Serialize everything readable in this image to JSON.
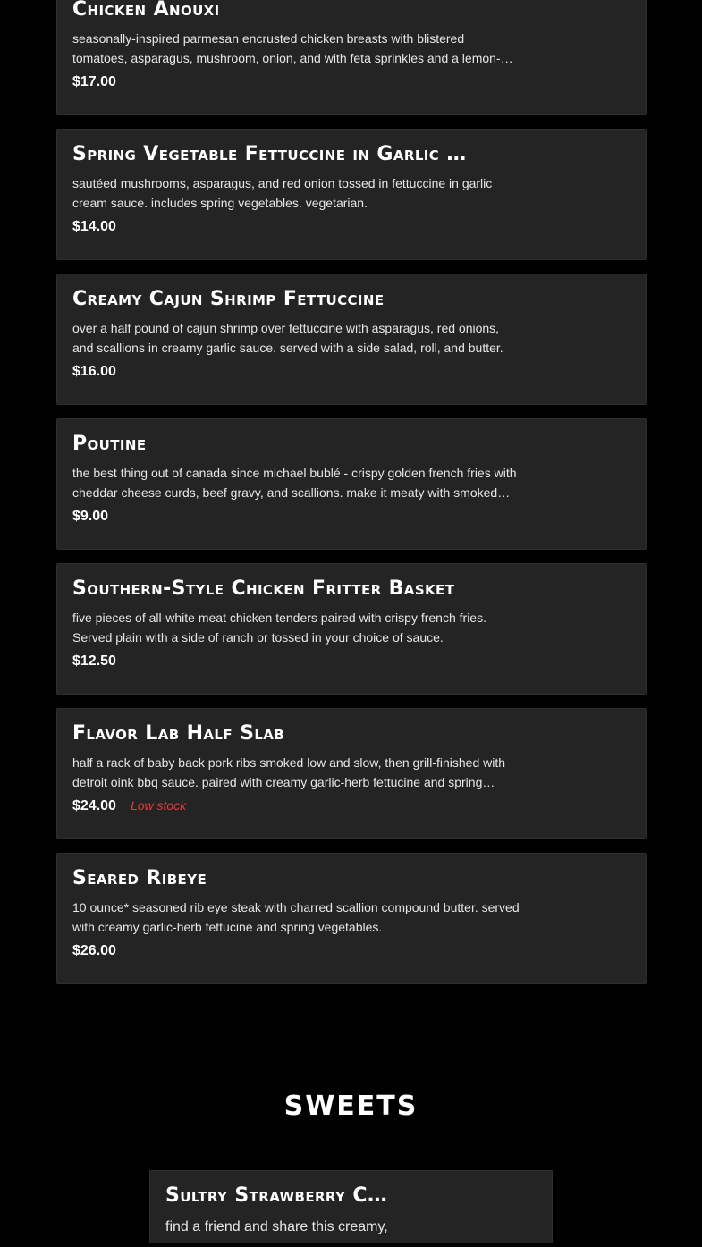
{
  "menu_items": [
    {
      "title": "Chicken Anouxi",
      "description": "seasonally-inspired parmesan encrusted chicken breasts with blistered tomatoes, asparagus, mushroom, onion, and with feta sprinkles and a lemon-herb cream sauce.",
      "price": "$17.00",
      "badge": ""
    },
    {
      "title": "Spring Vegetable Fettuccine in Garlic Cream Sauce",
      "description": "sautéed mushrooms, asparagus, and red onion tossed in fettuccine in garlic cream sauce. includes spring vegetables. vegetarian.",
      "price": "$14.00",
      "badge": ""
    },
    {
      "title": "Creamy Cajun Shrimp Fettuccine",
      "description": "over a half pound of cajun shrimp over fettuccine with asparagus, red onions, and scallions in creamy garlic sauce. served with a side salad, roll, and butter.",
      "price": "$16.00",
      "badge": ""
    },
    {
      "title": "Poutine",
      "description": "the best thing out of canada since michael bublé - crispy golden french fries with cheddar cheese curds, beef gravy, and scallions. make it meaty with smoked brisket or pulled pork.",
      "price": "$9.00",
      "badge": ""
    },
    {
      "title": "Southern-Style Chicken Fritter Basket",
      "description": "five pieces of all-white meat chicken tenders paired with crispy french fries. Served plain with a side of ranch or tossed in your choice of sauce.",
      "price": "$12.50",
      "badge": ""
    },
    {
      "title": "Flavor Lab Half Slab",
      "description": "half a rack of baby back pork ribs smoked low and slow, then grill-finished with detroit oink bbq sauce. paired with creamy garlic-herb fettucine and spring vegetables.",
      "price": "$24.00",
      "badge": "Low stock"
    },
    {
      "title": "Seared Ribeye",
      "description": "10 ounce* seasoned rib eye steak with charred scallion compound butter. served with creamy garlic-herb fettucine and spring vegetables.",
      "price": "$26.00",
      "badge": ""
    }
  ],
  "sweets": {
    "heading": "SWEETS",
    "item": {
      "title": "Sultry Strawberry Cheesecake",
      "description": "find a friend and share this creamy,"
    }
  },
  "colors": {
    "background": "#000000",
    "card": "#242424",
    "badge": "#e23b3b"
  }
}
